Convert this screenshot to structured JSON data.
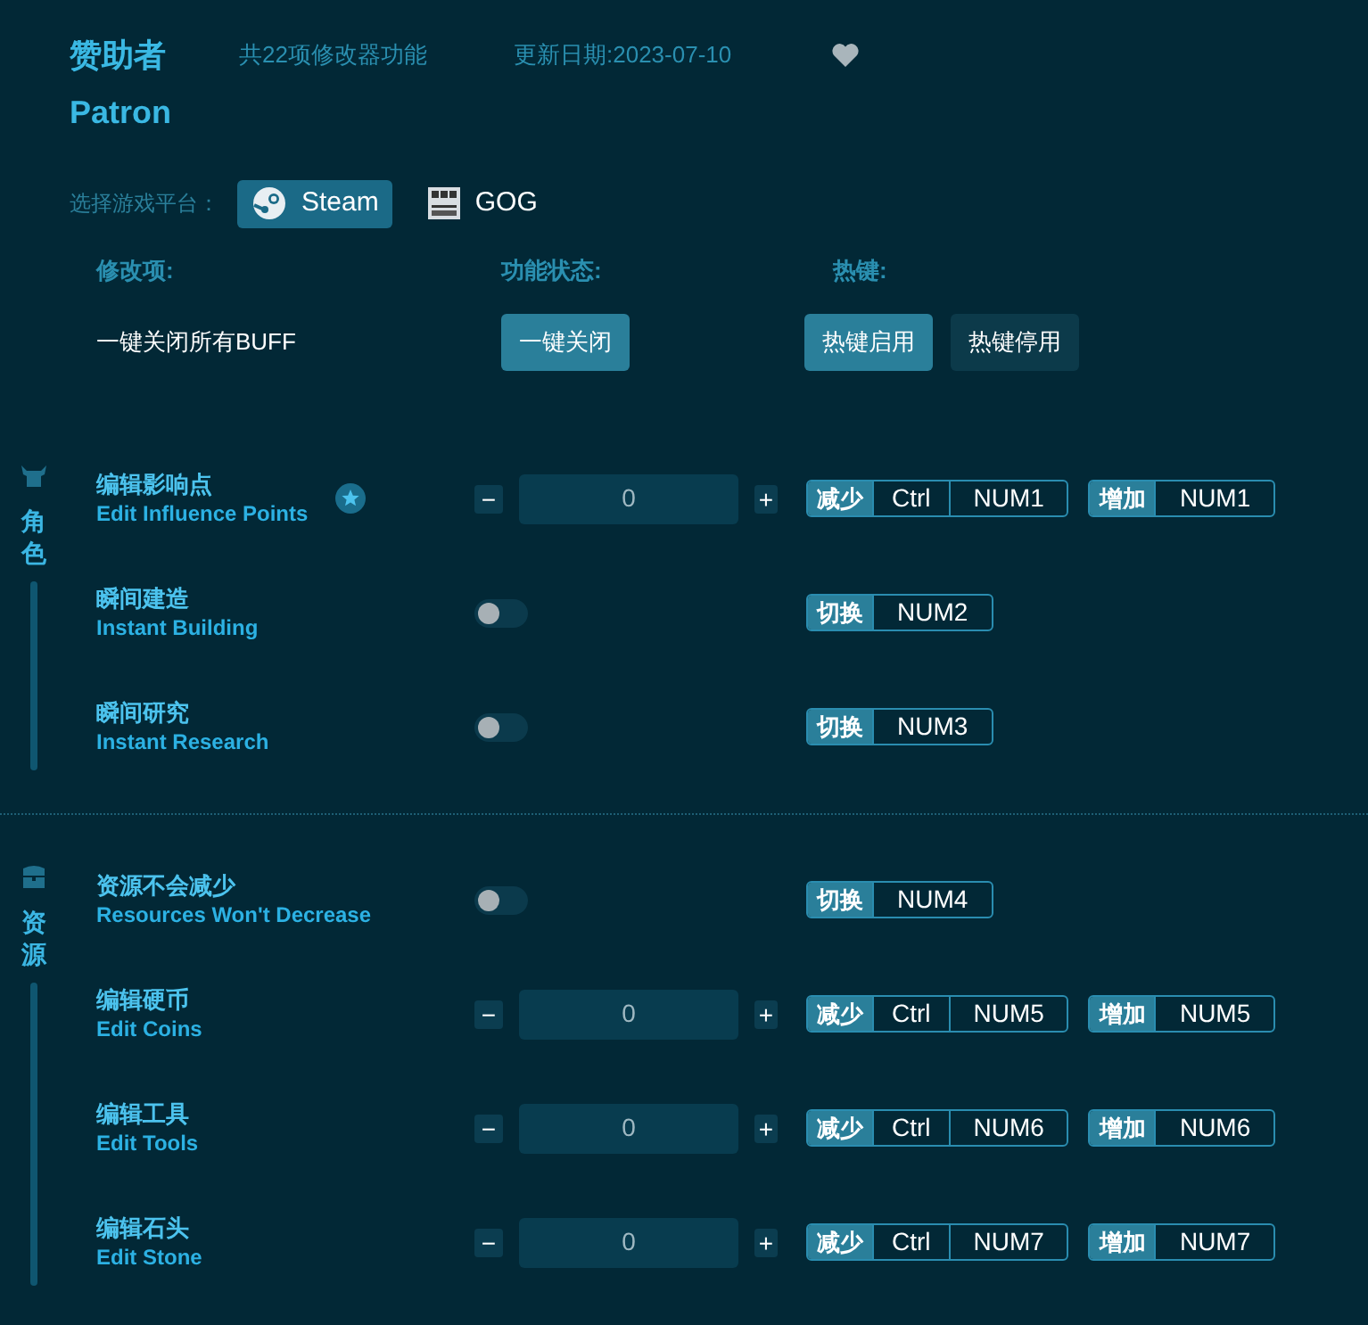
{
  "header": {
    "title": "赞助者",
    "feature_count": "共22项修改器功能",
    "updated": "更新日期:2023-07-10",
    "favorited": false,
    "subtitle": "Patron"
  },
  "platform": {
    "label": "选择游戏平台：",
    "options": [
      {
        "name": "Steam",
        "kind": "steam",
        "selected": true
      },
      {
        "name": "GOG",
        "kind": "gog",
        "selected": false
      }
    ]
  },
  "columns": [
    "修改项:",
    "功能状态:",
    "热键:"
  ],
  "global_row": {
    "label": "一键关闭所有BUFF",
    "action": "一键关闭",
    "hotkeys_on": {
      "label": "热键启用",
      "selected": true
    },
    "hotkeys_off": {
      "label": "热键停用",
      "selected": false
    }
  },
  "sections": [
    {
      "kind": "character",
      "title": "角色",
      "items": [
        {
          "name": "编辑影响点",
          "name_en": "Edit Influence Points",
          "kind": "number",
          "value": "0",
          "starred": true,
          "minus": "−",
          "plus": "+",
          "hotkeys": [
            {
              "label": "减少",
              "keys": [
                "Ctrl",
                "NUM1"
              ]
            },
            {
              "label": "增加",
              "keys": [
                "NUM1"
              ]
            }
          ]
        },
        {
          "name": "瞬间建造",
          "name_en": "Instant Building",
          "kind": "toggle",
          "on": false,
          "starred": false,
          "hotkeys": [
            {
              "label": "切换",
              "keys": [
                "NUM2"
              ]
            }
          ]
        },
        {
          "name": "瞬间研究",
          "name_en": "Instant Research",
          "kind": "toggle",
          "on": false,
          "starred": false,
          "hotkeys": [
            {
              "label": "切换",
              "keys": [
                "NUM3"
              ]
            }
          ]
        }
      ]
    },
    {
      "kind": "resources",
      "title": "资源",
      "items": [
        {
          "name": "资源不会减少",
          "name_en": "Resources Won't Decrease",
          "kind": "toggle",
          "on": false,
          "starred": false,
          "hotkeys": [
            {
              "label": "切换",
              "keys": [
                "NUM4"
              ]
            }
          ]
        },
        {
          "name": "编辑硬币",
          "name_en": "Edit Coins",
          "kind": "number",
          "value": "0",
          "starred": false,
          "minus": "−",
          "plus": "+",
          "hotkeys": [
            {
              "label": "减少",
              "keys": [
                "Ctrl",
                "NUM5"
              ]
            },
            {
              "label": "增加",
              "keys": [
                "NUM5"
              ]
            }
          ]
        },
        {
          "name": "编辑工具",
          "name_en": "Edit Tools",
          "kind": "number",
          "value": "0",
          "starred": false,
          "minus": "−",
          "plus": "+",
          "hotkeys": [
            {
              "label": "减少",
              "keys": [
                "Ctrl",
                "NUM6"
              ]
            },
            {
              "label": "增加",
              "keys": [
                "NUM6"
              ]
            }
          ]
        },
        {
          "name": "编辑石头",
          "name_en": "Edit Stone",
          "kind": "number",
          "value": "0",
          "starred": false,
          "minus": "−",
          "plus": "+",
          "hotkeys": [
            {
              "label": "减少",
              "keys": [
                "Ctrl",
                "NUM7"
              ]
            },
            {
              "label": "增加",
              "keys": [
                "NUM7"
              ]
            }
          ]
        }
      ]
    }
  ]
}
